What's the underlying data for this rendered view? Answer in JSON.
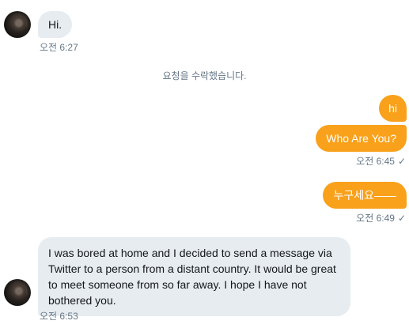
{
  "messages": [
    {
      "text": "Hi.",
      "time": "오전 6:27"
    },
    {
      "text": "hi"
    },
    {
      "text": "Who Are You?",
      "time": "오전 6:45",
      "status": "✓"
    },
    {
      "text": "누구세요——",
      "time": "오전 6:49",
      "status": "✓"
    },
    {
      "text": "I was bored at home and I decided to send a message via Twitter to a person from a distant country. It would be great to meet someone from so far away. I hope I have not bothered you.",
      "time": "오전 6:53"
    }
  ],
  "system_message": "요청을 수락했습니다.",
  "colors": {
    "outgoing": "#f9a11b",
    "incoming": "#e6ecf0",
    "meta": "#657786"
  }
}
